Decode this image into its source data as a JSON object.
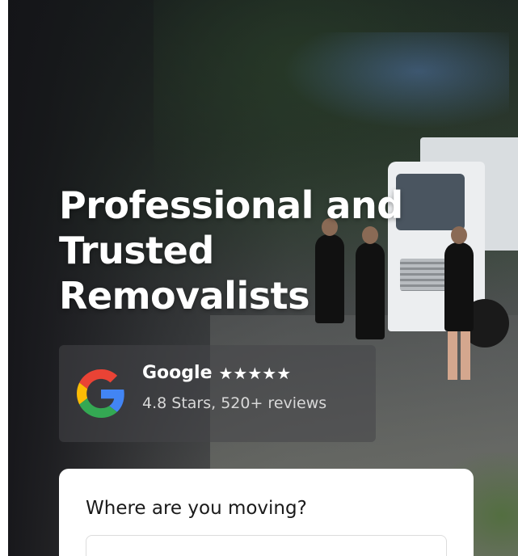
{
  "hero": {
    "headline_lines": [
      "Professional and",
      "Trusted",
      "Removalists"
    ]
  },
  "review": {
    "brand": "Google",
    "stars": "★★★★★",
    "rating_value": 4.8,
    "summary": "4.8 Stars, 520+ reviews",
    "icon": "google-g-logo"
  },
  "form": {
    "title": "Where are you moving?",
    "input_placeholder": ""
  },
  "colors": {
    "overlay": "#141418",
    "headline": "#ffffff",
    "card_bg": "#ffffff",
    "google_blue": "#4285F4",
    "google_red": "#EA4335",
    "google_yellow": "#FBBC05",
    "google_green": "#34A853"
  }
}
